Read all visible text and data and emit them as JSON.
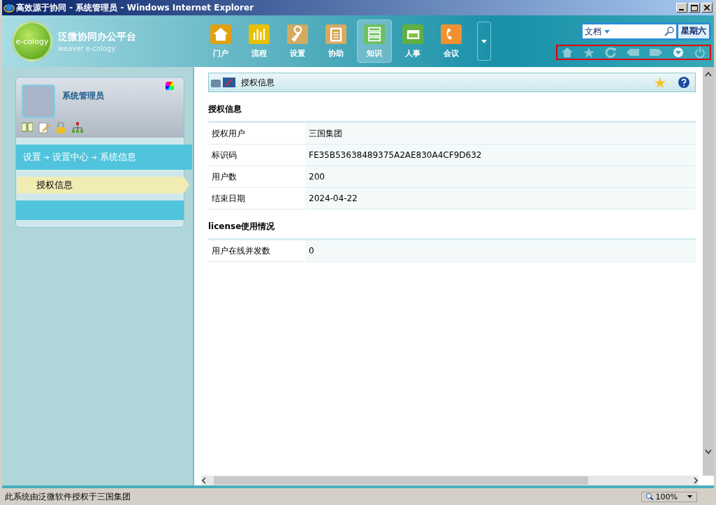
{
  "window": {
    "title": "高效源于协同 - 系统管理员 - Windows Internet Explorer"
  },
  "header": {
    "logo": "e-cology",
    "platform_name": "泛微协同办公平台",
    "platform_subtitle": "weaver e-cology",
    "nav": [
      {
        "label": "门户",
        "kind": "home",
        "selected": false
      },
      {
        "label": "流程",
        "kind": "chart",
        "selected": false
      },
      {
        "label": "设置",
        "kind": "wrench",
        "selected": false
      },
      {
        "label": "协助",
        "kind": "clipboard",
        "selected": false
      },
      {
        "label": "知识",
        "kind": "server",
        "selected": true
      },
      {
        "label": "人事",
        "kind": "card",
        "selected": false
      },
      {
        "label": "会议",
        "kind": "phone",
        "selected": false
      }
    ],
    "search": {
      "category": "文档"
    },
    "weekday": "星期六"
  },
  "sidebar": {
    "user_name": "系统管理员",
    "breadcrumb": [
      "设置",
      "设置中心",
      "系统信息"
    ],
    "items": [
      {
        "label": "授权信息",
        "selected": true
      }
    ]
  },
  "content": {
    "title": "授权信息",
    "sections": [
      {
        "heading": "授权信息",
        "rows": [
          {
            "label": "授权用户",
            "value": "三国集团"
          },
          {
            "label": "标识码",
            "value": "FE35B53638489375A2AE830A4CF9D632"
          },
          {
            "label": "用户数",
            "value": "200"
          },
          {
            "label": "结束日期",
            "value": "2024-04-22"
          }
        ]
      },
      {
        "heading": "license使用情况",
        "rows": [
          {
            "label": "用户在线并发数",
            "value": "0"
          }
        ]
      }
    ]
  },
  "status_bar": {
    "text": "此系统由泛微软件授权于三国集团",
    "zoom": "100%"
  }
}
